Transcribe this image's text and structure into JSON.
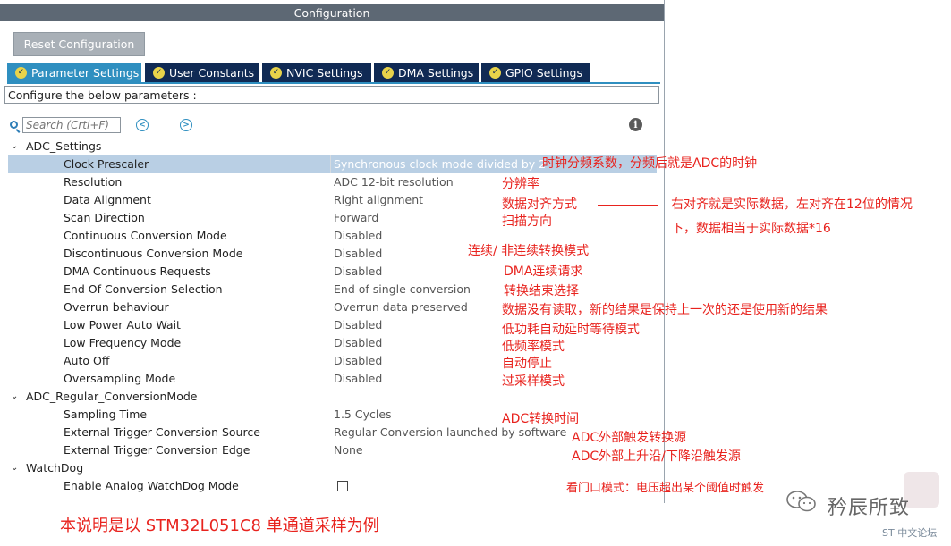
{
  "window": {
    "title": "Configuration"
  },
  "toolbar": {
    "reset_label": "Reset Configuration"
  },
  "tabs": [
    {
      "label": "Parameter Settings",
      "active": true
    },
    {
      "label": "User Constants",
      "active": false
    },
    {
      "label": "NVIC Settings",
      "active": false
    },
    {
      "label": "DMA Settings",
      "active": false
    },
    {
      "label": "GPIO Settings",
      "active": false
    }
  ],
  "description": "Configure the below parameters :",
  "search": {
    "placeholder": "Search (Crtl+F)"
  },
  "sections": {
    "adc_settings": "ADC_Settings",
    "adc_regular": "ADC_Regular_ConversionMode",
    "watchdog": "WatchDog"
  },
  "params": [
    {
      "label": "Clock Prescaler",
      "value": "Synchronous clock mode divided by 2"
    },
    {
      "label": "Resolution",
      "value": "ADC 12-bit resolution"
    },
    {
      "label": "Data Alignment",
      "value": "Right alignment"
    },
    {
      "label": "Scan Direction",
      "value": "Forward"
    },
    {
      "label": "Continuous Conversion Mode",
      "value": "Disabled"
    },
    {
      "label": "Discontinuous Conversion Mode",
      "value": "Disabled"
    },
    {
      "label": "DMA Continuous Requests",
      "value": "Disabled"
    },
    {
      "label": "End Of Conversion Selection",
      "value": "End of single conversion"
    },
    {
      "label": "Overrun behaviour",
      "value": "Overrun data preserved"
    },
    {
      "label": "Low Power Auto Wait",
      "value": "Disabled"
    },
    {
      "label": "Low Frequency Mode",
      "value": "Disabled"
    },
    {
      "label": "Auto Off",
      "value": "Disabled"
    },
    {
      "label": "Oversampling Mode",
      "value": "Disabled"
    },
    {
      "label": "Sampling Time",
      "value": "1.5 Cycles"
    },
    {
      "label": "External Trigger Conversion Source",
      "value": "Regular Conversion launched by software"
    },
    {
      "label": "External Trigger Conversion Edge",
      "value": "None"
    },
    {
      "label": "Enable Analog WatchDog Mode",
      "checked": false
    }
  ],
  "annotations": {
    "clock": "时钟分频系数，分频后就是ADC的时钟",
    "resolution": "分辨率",
    "alignment": "数据对齐方式",
    "alignment_note_1": "右对齐就是实际数据，左对齐在12位的情况",
    "alignment_note_2": "下，数据相当于实际数据*16",
    "scan": "扫描方向",
    "continuous": "连续/ 非连续转换模式",
    "dma": "DMA连续请求",
    "eoc": "转换结束选择",
    "overrun": "数据没有读取，新的结果是保持上一次的还是使用新的结果",
    "low_power": "低功耗自动延时等待模式",
    "low_freq": "低频率模式",
    "auto_off": "自动停止",
    "oversampling": "过采样模式",
    "sampling_time": "ADC转换时间",
    "ext_source": "ADC外部触发转换源",
    "ext_edge": "ADC外部上升沿/下降沿触发源",
    "watchdog": "看门口模式：电压超出某个阈值时触发",
    "footer": "本说明是以 STM32L051C8 单通道采样为例"
  },
  "watermark": {
    "title": "矜辰所致",
    "sub": "ST 中文论坛"
  },
  "colors": {
    "annotation": "#e8231e",
    "tab_active": "#2f8fc0",
    "tab_inactive": "#102a54",
    "title_bar": "#5d6874",
    "selected_row": "#b9cfe4"
  }
}
